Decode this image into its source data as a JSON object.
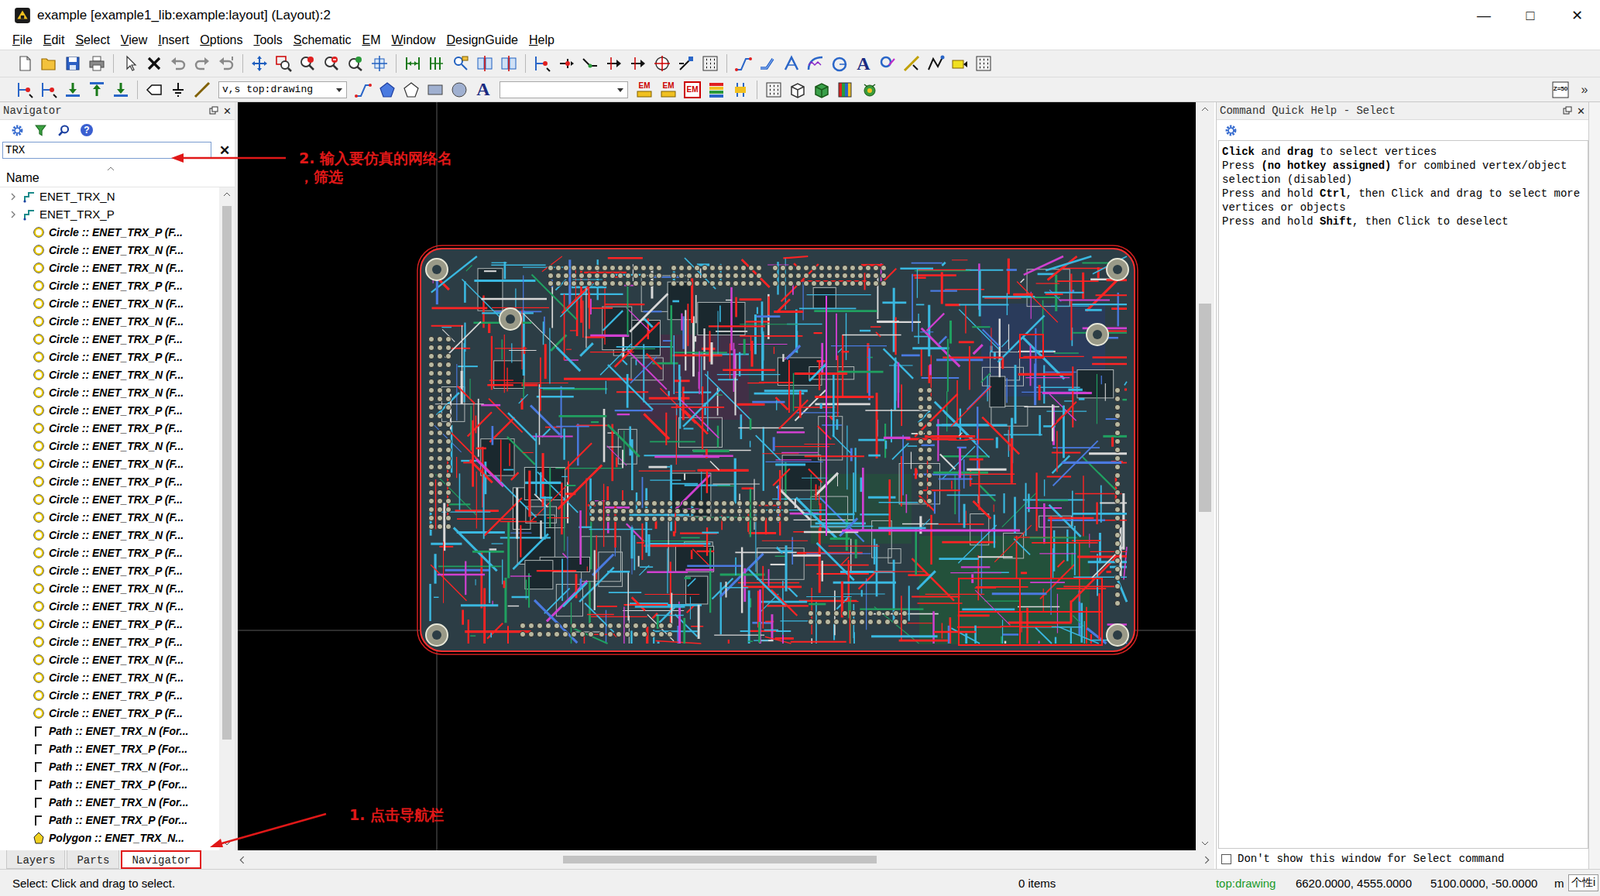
{
  "window": {
    "title": "example [example1_lib:example:layout] (Layout):2",
    "controls": [
      "—",
      "□",
      "✕"
    ]
  },
  "menu": [
    "File",
    "Edit",
    "Select",
    "View",
    "Insert",
    "Options",
    "Tools",
    "Schematic",
    "EM",
    "Window",
    "DesignGuide",
    "Help"
  ],
  "toolbar_top": [
    {
      "kind": "new"
    },
    {
      "kind": "open"
    },
    {
      "kind": "save"
    },
    {
      "kind": "print"
    },
    {
      "kind": "separator"
    },
    {
      "kind": "pointer"
    },
    {
      "kind": "delete"
    },
    {
      "kind": "undo"
    },
    {
      "kind": "redo"
    },
    {
      "kind": "history"
    },
    {
      "kind": "separator"
    },
    {
      "kind": "move"
    },
    {
      "kind": "zoom-area"
    },
    {
      "kind": "zoom-in"
    },
    {
      "kind": "zoom-out"
    },
    {
      "kind": "zoom-fit"
    },
    {
      "kind": "pan"
    },
    {
      "kind": "separator"
    },
    {
      "kind": "dim-h"
    },
    {
      "kind": "dim-v"
    },
    {
      "kind": "ruler"
    },
    {
      "kind": "align"
    },
    {
      "kind": "align"
    },
    {
      "kind": "separator"
    },
    {
      "kind": "route"
    },
    {
      "kind": "snap"
    },
    {
      "kind": "wire"
    },
    {
      "kind": "pin"
    },
    {
      "kind": "pin"
    },
    {
      "kind": "target"
    },
    {
      "kind": "probe"
    },
    {
      "kind": "grid"
    },
    {
      "kind": "separator"
    },
    {
      "kind": "trace"
    },
    {
      "kind": "bend"
    },
    {
      "kind": "miter"
    },
    {
      "kind": "curve"
    },
    {
      "kind": "arc"
    },
    {
      "kind": "text",
      "label": "A"
    },
    {
      "kind": "cut"
    },
    {
      "kind": "step"
    },
    {
      "kind": "shape"
    },
    {
      "kind": "flag"
    },
    {
      "kind": "grid"
    }
  ],
  "toolbar_bottom": [
    {
      "kind": "route"
    },
    {
      "kind": "route"
    },
    {
      "kind": "place-down"
    },
    {
      "kind": "place-up"
    },
    {
      "kind": "place-down"
    },
    {
      "kind": "separator"
    },
    {
      "kind": "port"
    },
    {
      "kind": "ground"
    },
    {
      "kind": "line"
    },
    {
      "kind": "dropdown",
      "value": "v,s top:drawing"
    },
    {
      "kind": "trace"
    },
    {
      "kind": "polygon"
    },
    {
      "kind": "polygon2"
    },
    {
      "kind": "rect"
    },
    {
      "kind": "circle"
    },
    {
      "kind": "text",
      "label": "A"
    },
    {
      "kind": "dropdown",
      "value": ""
    },
    {
      "kind": "em",
      "label": "EM"
    },
    {
      "kind": "em",
      "label": "EM"
    },
    {
      "kind": "em-box",
      "label": "EM"
    },
    {
      "kind": "layers"
    },
    {
      "kind": "bars"
    },
    {
      "kind": "separator"
    },
    {
      "kind": "grid"
    },
    {
      "kind": "cube"
    },
    {
      "kind": "cube2"
    },
    {
      "kind": "palette"
    },
    {
      "kind": "bug"
    }
  ],
  "toolbar_bottom_right": [
    {
      "kind": "z50",
      "label": "Z=50"
    },
    {
      "kind": "more",
      "label": "»"
    }
  ],
  "navigator": {
    "title": "Navigator",
    "close": "✕",
    "tools": [
      {
        "kind": "gear"
      },
      {
        "kind": "filter"
      },
      {
        "kind": "find"
      },
      {
        "kind": "help",
        "label": "?"
      }
    ],
    "search": "TRX",
    "clear": "✕",
    "column": "Name",
    "items": [
      {
        "kind": "net",
        "label": "ENET_TRX_N",
        "expanded": false
      },
      {
        "kind": "net",
        "label": "ENET_TRX_P",
        "expanded": false
      },
      {
        "kind": "circle",
        "label": "Circle :: ENET_TRX_P (F..."
      },
      {
        "kind": "circle",
        "label": "Circle :: ENET_TRX_N (F..."
      },
      {
        "kind": "circle",
        "label": "Circle :: ENET_TRX_N (F..."
      },
      {
        "kind": "circle",
        "label": "Circle :: ENET_TRX_P (F..."
      },
      {
        "kind": "circle",
        "label": "Circle :: ENET_TRX_N (F..."
      },
      {
        "kind": "circle",
        "label": "Circle :: ENET_TRX_N (F..."
      },
      {
        "kind": "circle",
        "label": "Circle :: ENET_TRX_P (F..."
      },
      {
        "kind": "circle",
        "label": "Circle :: ENET_TRX_P (F..."
      },
      {
        "kind": "circle",
        "label": "Circle :: ENET_TRX_N (F..."
      },
      {
        "kind": "circle",
        "label": "Circle :: ENET_TRX_N (F..."
      },
      {
        "kind": "circle",
        "label": "Circle :: ENET_TRX_P (F..."
      },
      {
        "kind": "circle",
        "label": "Circle :: ENET_TRX_P (F..."
      },
      {
        "kind": "circle",
        "label": "Circle :: ENET_TRX_N (F..."
      },
      {
        "kind": "circle",
        "label": "Circle :: ENET_TRX_N (F..."
      },
      {
        "kind": "circle",
        "label": "Circle :: ENET_TRX_P (F..."
      },
      {
        "kind": "circle",
        "label": "Circle :: ENET_TRX_P (F..."
      },
      {
        "kind": "circle",
        "label": "Circle :: ENET_TRX_N (F..."
      },
      {
        "kind": "circle",
        "label": "Circle :: ENET_TRX_N (F..."
      },
      {
        "kind": "circle",
        "label": "Circle :: ENET_TRX_P (F..."
      },
      {
        "kind": "circle",
        "label": "Circle :: ENET_TRX_P (F..."
      },
      {
        "kind": "circle",
        "label": "Circle :: ENET_TRX_N (F..."
      },
      {
        "kind": "circle",
        "label": "Circle :: ENET_TRX_N (F..."
      },
      {
        "kind": "circle",
        "label": "Circle :: ENET_TRX_P (F..."
      },
      {
        "kind": "circle",
        "label": "Circle :: ENET_TRX_P (F..."
      },
      {
        "kind": "circle",
        "label": "Circle :: ENET_TRX_N (F..."
      },
      {
        "kind": "circle",
        "label": "Circle :: ENET_TRX_N (F..."
      },
      {
        "kind": "circle",
        "label": "Circle :: ENET_TRX_P (F..."
      },
      {
        "kind": "circle",
        "label": "Circle :: ENET_TRX_P (F..."
      },
      {
        "kind": "path",
        "label": "Path :: ENET_TRX_N (For..."
      },
      {
        "kind": "path",
        "label": "Path :: ENET_TRX_P (For..."
      },
      {
        "kind": "path",
        "label": "Path :: ENET_TRX_N (For..."
      },
      {
        "kind": "path",
        "label": "Path :: ENET_TRX_P (For..."
      },
      {
        "kind": "path",
        "label": "Path :: ENET_TRX_N (For..."
      },
      {
        "kind": "path",
        "label": "Path :: ENET_TRX_P (For..."
      },
      {
        "kind": "polygon",
        "label": "Polygon :: ENET_TRX_N..."
      }
    ]
  },
  "bottom_tabs": [
    {
      "label": "Layers",
      "selected": false,
      "outlined": false
    },
    {
      "label": "Parts",
      "selected": false,
      "outlined": false
    },
    {
      "label": "Navigator",
      "selected": true,
      "outlined": true
    }
  ],
  "help": {
    "title": "Command Quick Help - Select",
    "close": "✕",
    "lines": [
      [
        {
          "t": "Click",
          "b": true
        },
        {
          "t": " and ",
          "b": false
        },
        {
          "t": "drag",
          "b": true
        },
        {
          "t": " to select vertices",
          "b": false
        }
      ],
      [
        {
          "t": "Press ",
          "b": false
        },
        {
          "t": "(no hotkey assigned)",
          "b": true
        },
        {
          "t": " for combined vertex/object",
          "b": false
        }
      ],
      [
        {
          "t": "selection (disabled)",
          "b": false
        }
      ],
      [
        {
          "t": "Press and hold ",
          "b": false
        },
        {
          "t": "Ctrl",
          "b": true
        },
        {
          "t": ", then Click and drag to select more",
          "b": false
        }
      ],
      [
        {
          "t": "vertices or objects",
          "b": false
        }
      ],
      [
        {
          "t": "Press and hold ",
          "b": false
        },
        {
          "t": "Shift",
          "b": true
        },
        {
          "t": ", then Click to deselect",
          "b": false
        }
      ]
    ],
    "checkbox": {
      "label": "Don't show this window for Select command",
      "checked": false
    }
  },
  "status": {
    "message": "Select: Click and drag to select.",
    "count": "0 items",
    "layer": "top:drawing",
    "cursor": "6620.0000, 4555.0000",
    "delta": "5100.0000, -50.0000",
    "unit": "m",
    "ime": "个性i"
  },
  "annotations": [
    {
      "lines": [
        "2. 输入要仿真的网络名",
        "，筛选"
      ]
    },
    {
      "lines": [
        "1. 点击导航栏"
      ]
    }
  ]
}
